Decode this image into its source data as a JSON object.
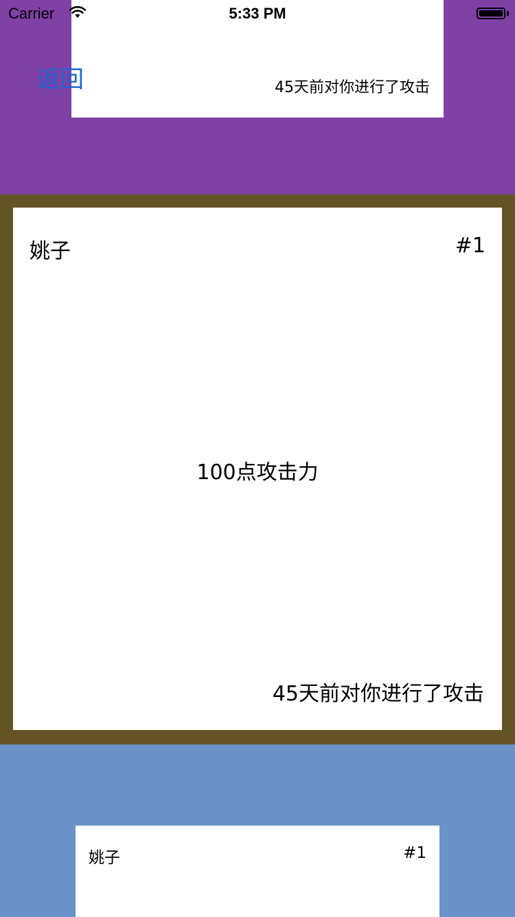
{
  "status_bar": {
    "carrier": "Carrier",
    "time": "5:33 PM",
    "wifi_icon": "wifi-icon",
    "battery_icon": "battery-icon"
  },
  "nav": {
    "back_label": "返回"
  },
  "colors": {
    "top_band": "#7f41a5",
    "middle_band": "#645425",
    "bottom_band": "#6a93c7",
    "back_link": "#1a66d6"
  },
  "cards": {
    "previous": {
      "footer": "45天前对你进行了攻击"
    },
    "current": {
      "name": "姚子",
      "rank": "#1",
      "attack": "100点攻击力",
      "footer": "45天前对你进行了攻击"
    },
    "next": {
      "name": "姚子",
      "rank": "#1"
    }
  }
}
